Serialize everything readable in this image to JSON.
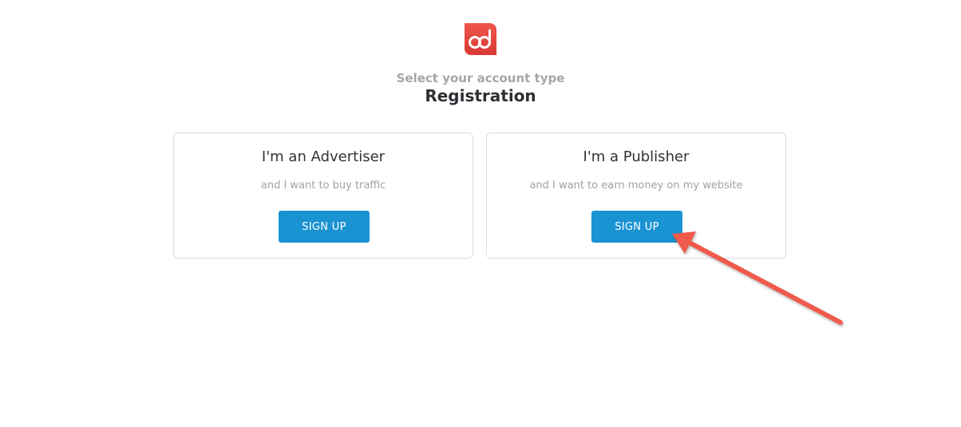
{
  "header": {
    "subtitle": "Select your account type",
    "title": "Registration"
  },
  "logo": {
    "icon": "ad-logo-icon",
    "color": "#e8453c"
  },
  "cards": [
    {
      "title": "I'm an Advertiser",
      "description": "and I want to buy traffic",
      "button_label": "SIGN UP"
    },
    {
      "title": "I'm a Publisher",
      "description": "and I want to earn money on my website",
      "button_label": "SIGN UP"
    }
  ],
  "annotation": {
    "icon": "pointer-arrow-icon",
    "color": "#ef5a4c"
  },
  "colors": {
    "button": "#1a93d3",
    "card_border": "#dcdfe3"
  }
}
